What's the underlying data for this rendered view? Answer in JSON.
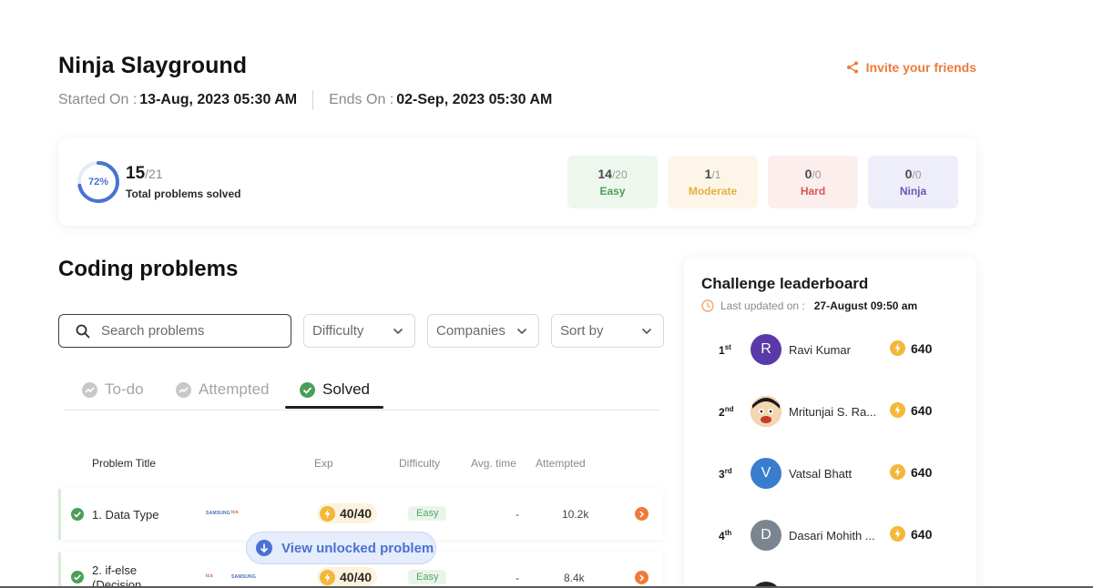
{
  "header": {
    "title": "Ninja Slayground",
    "invite_label": "Invite your friends",
    "started_label": "Started On :",
    "started_value": "13-Aug, 2023 05:30 AM",
    "ends_label": "Ends On :",
    "ends_value": "02-Sep, 2023 05:30 AM"
  },
  "summary": {
    "percent_label": "72%",
    "progress_fraction": 0.72,
    "solved": "15",
    "total": "/21",
    "solved_label": "Total problems solved",
    "difficulties": [
      {
        "solved": "14",
        "total": "/20",
        "label": "Easy"
      },
      {
        "solved": "1",
        "total": "/1",
        "label": "Moderate"
      },
      {
        "solved": "0",
        "total": "/0",
        "label": "Hard"
      },
      {
        "solved": "0",
        "total": "/0",
        "label": "Ninja"
      }
    ]
  },
  "problems": {
    "section_title": "Coding problems",
    "search_placeholder": "Search problems",
    "filters": {
      "difficulty": "Difficulty",
      "companies": "Companies",
      "sort": "Sort by"
    },
    "tabs": [
      {
        "label": "To-do"
      },
      {
        "label": "Attempted"
      },
      {
        "label": "Solved"
      }
    ],
    "columns": {
      "title": "Problem Title",
      "exp": "Exp",
      "difficulty": "Difficulty",
      "avg_time": "Avg. time",
      "attempted": "Attempted"
    },
    "rows": [
      {
        "title": "1. Data Type",
        "logo_a": "SAMSUNG",
        "logo_b": "tcs",
        "exp": "40/40",
        "difficulty": "Easy",
        "avg_time": "-",
        "attempted": "10.2k"
      },
      {
        "title_line1": "2. if-else",
        "title_line2": "(Decision",
        "logo_a": "tcs",
        "logo_b": "SAMSUNG",
        "exp": "40/40",
        "difficulty": "Easy",
        "avg_time": "-",
        "attempted": "8.4k"
      }
    ],
    "toast_label": "View unlocked problem"
  },
  "leaderboard": {
    "title": "Challenge leaderboard",
    "updated_label": "Last updated on :",
    "updated_value": "27-August 09:50 am",
    "entries": [
      {
        "rank": "1",
        "suffix": "st",
        "initial": "R",
        "name": "Ravi Kumar",
        "score": "640",
        "color": "#5a3aa8"
      },
      {
        "rank": "2",
        "suffix": "nd",
        "initial": "",
        "name": "Mritunjai S. Ra...",
        "score": "640",
        "color": "#e24a3a"
      },
      {
        "rank": "3",
        "suffix": "rd",
        "initial": "V",
        "name": "Vatsal Bhatt",
        "score": "640",
        "color": "#3a7dce"
      },
      {
        "rank": "4",
        "suffix": "th",
        "initial": "D",
        "name": "Dasari Mohith ...",
        "score": "640",
        "color": "#7b8590"
      }
    ]
  },
  "colors": {
    "accent": "#ec7c3a",
    "blue": "#4a72d4",
    "green": "#4a9f58"
  }
}
